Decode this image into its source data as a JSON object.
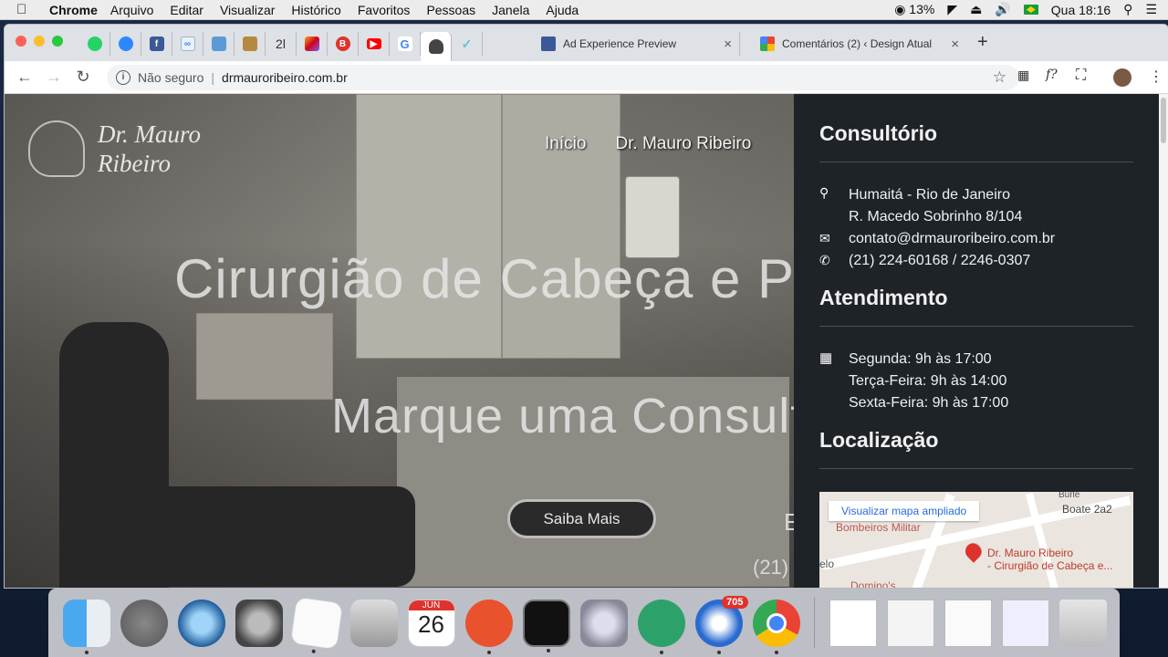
{
  "menubar": {
    "app_name": "Chrome",
    "items": [
      "Arquivo",
      "Editar",
      "Visualizar",
      "Histórico",
      "Favoritos",
      "Pessoas",
      "Janela",
      "Ajuda"
    ],
    "battery": "13%",
    "clock": "Qua 18:16"
  },
  "tabs": {
    "pinned_text": "2l",
    "tab1_title": "Ad Experience Preview",
    "tab2_title": "Comentários (2) ‹ Design Atual",
    "new_tab": "+"
  },
  "toolbar": {
    "security_label": "Não seguro",
    "url": "drmauroribeiro.com.br",
    "ext_label": "f?"
  },
  "site": {
    "logo_line1": "Dr. Mauro",
    "logo_line2": "Ribeiro",
    "nav": [
      "Início",
      "Dr. Mauro Ribeiro"
    ],
    "hero_title": "Cirurgião de Cabeça e P",
    "hero_subtitle": "Marque uma Consult",
    "cta_label": "Saiba Mais",
    "hero_phone_fragment": "(21)",
    "hero_e_fragment": "E"
  },
  "sidebar": {
    "consultorio_title": "Consultório",
    "address_line1": "Humaitá - Rio de Janeiro",
    "address_line2": "R. Macedo Sobrinho 8/104",
    "email": "contato@drmauroribeiro.com.br",
    "phone": "(21) 224-60168 / 2246-0307",
    "atendimento_title": "Atendimento",
    "hours": [
      "Segunda: 9h às 17:00",
      "Terça-Feira: 9h às 14:00",
      "Sexta-Feira: 9h às 17:00"
    ],
    "localizacao_title": "Localização",
    "map": {
      "button": "Visualizar mapa ampliado",
      "label_bombeiros": "Bombeiros Militar",
      "label_boate": "Boate 2a2",
      "label_dominos": "Domino's",
      "label_burle": "Burle",
      "label_elo": "elo",
      "place_line1": "Dr. Mauro Ribeiro",
      "place_line2": "- Cirurgião de Cabeça e..."
    }
  },
  "dock": {
    "calendar_month": "JUN",
    "calendar_day": "26",
    "mail_badge": "705"
  },
  "colors": {
    "sidebar_bg": "#1e2328",
    "map_pin": "#e0322c"
  }
}
